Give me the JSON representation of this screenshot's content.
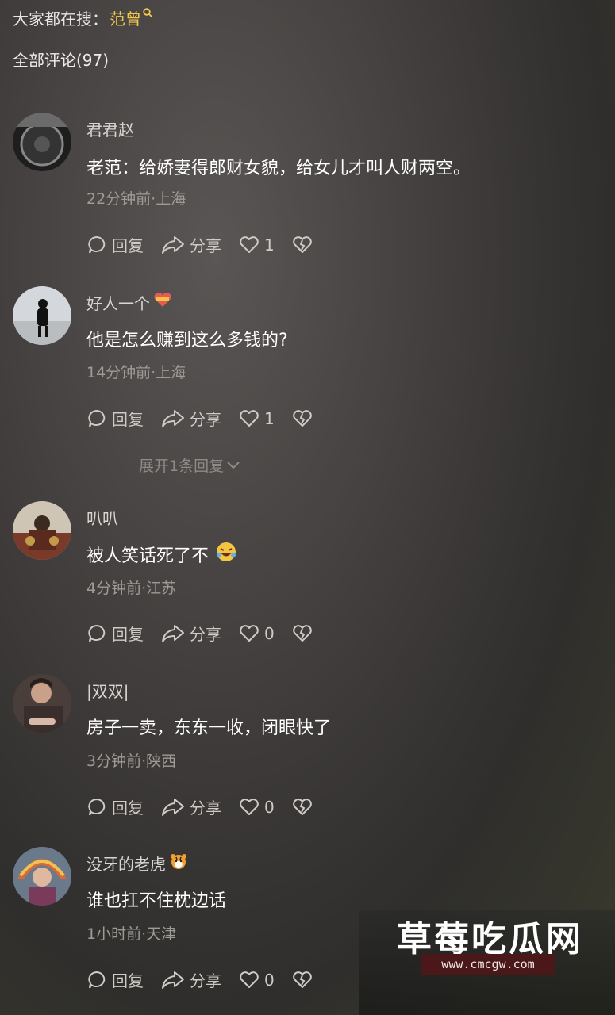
{
  "search": {
    "prefix": "大家都在搜：",
    "keyword": "范曾"
  },
  "total_label": "全部评论(97)",
  "actions": {
    "reply": "回复",
    "share": "分享"
  },
  "expand_replies": "展开1条回复",
  "comments": [
    {
      "name": "君君赵",
      "text": "老范：给娇妻得郎财女貌，给女儿才叫人财两空。",
      "meta": "22分钟前·上海",
      "likes": "1"
    },
    {
      "name": "好人一个",
      "text": "他是怎么赚到这么多钱的?",
      "meta": "14分钟前·上海",
      "likes": "1"
    },
    {
      "name": "叭叭",
      "text": "被人笑话死了不",
      "meta": "4分钟前·江苏",
      "likes": "0"
    },
    {
      "name": "|双双|",
      "text": "房子一卖，东东一收，闭眼快了",
      "meta": "3分钟前·陕西",
      "likes": "0"
    },
    {
      "name": "没牙的老虎",
      "text": "谁也扛不住枕边话",
      "meta": "1小时前·天津",
      "likes": "0"
    }
  ],
  "watermark": {
    "title": "草莓吃瓜网",
    "url": "www.cmcgw.com"
  },
  "colors": {
    "keyword": "#f2c94c",
    "text": "#ffffff",
    "meta": "#9f9b97"
  }
}
